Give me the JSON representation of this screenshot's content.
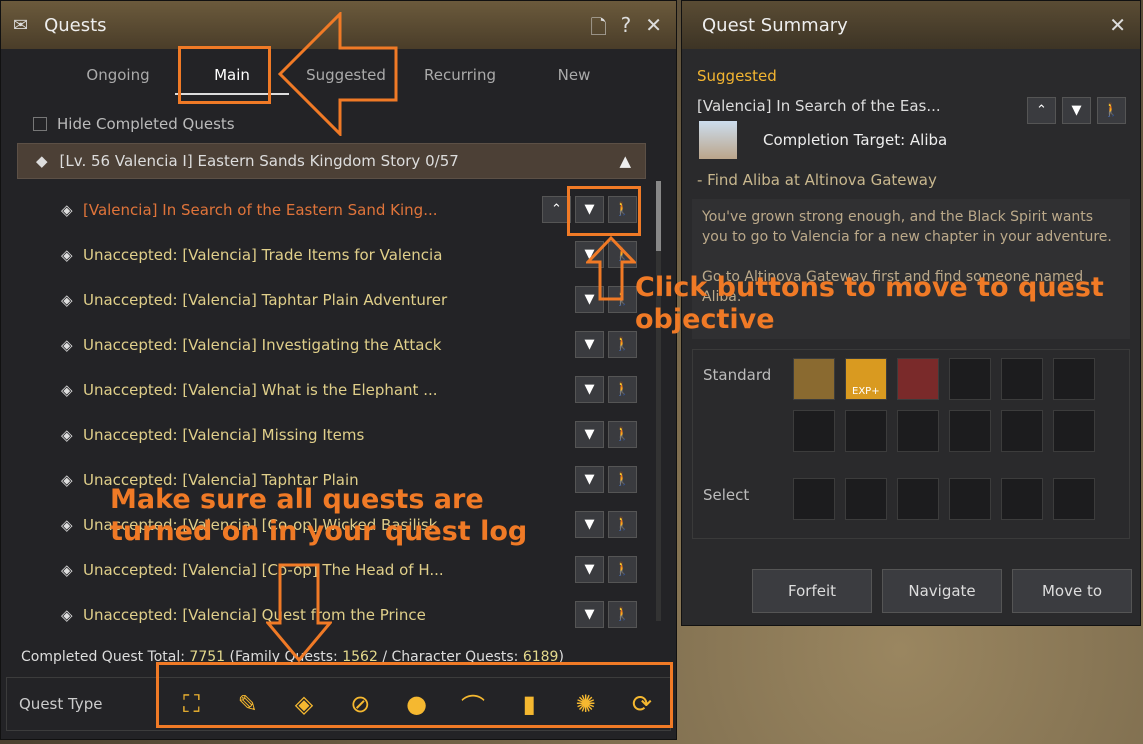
{
  "quests": {
    "title": "Quests",
    "tabs": [
      "Ongoing",
      "Main",
      "Suggested",
      "Recurring",
      "New"
    ],
    "active_tab": "Main",
    "hide_completed": "Hide Completed Quests",
    "group": {
      "title": "[Lv. 56 Valencia I] Eastern Sands Kingdom Story",
      "progress": "0/57"
    },
    "items": [
      "[Valencia] In Search of the Eastern Sand King...",
      "Unaccepted: [Valencia] Trade Items for Valencia",
      "Unaccepted: [Valencia] Taphtar Plain Adventurer",
      "Unaccepted: [Valencia] Investigating the Attack",
      "Unaccepted: [Valencia] What is the Elephant ...",
      "Unaccepted: [Valencia] Missing Items",
      "Unaccepted: [Valencia] Taphtar Plain",
      "Unaccepted: [Valencia] [Co-op] Wicked Basilisk",
      "Unaccepted: [Valencia] [Co-op] The Head of H...",
      "Unaccepted: [Valencia] Quest from the Prince"
    ],
    "total_label": "Completed Quest Total:",
    "total": "7751",
    "family_label": "(Family Quests:",
    "family": "1562",
    "char_label": "/ Character Quests:",
    "char": "6189",
    "quest_type_label": "Quest Type",
    "quest_type_icons": [
      "all-icon",
      "scroll-alert-icon",
      "diamond-icon",
      "feather-icon",
      "globe-icon",
      "pickaxe-icon",
      "book-icon",
      "party-icon",
      "repeat-icon"
    ]
  },
  "summary": {
    "title": "Quest Summary",
    "category": "Suggested",
    "quest": "[Valencia] In Search of the Eas...",
    "target": "Completion Target: Aliba",
    "objective": "- Find Aliba at Altinova Gateway",
    "desc1": "You've grown strong enough, and the Black Spirit wants you to go to Valencia for a new chapter in your adventure.",
    "desc2": "Go to Altinova Gateway first and find someone named Aliba.",
    "standard": "Standard",
    "select": "Select",
    "forfeit": "Forfeit",
    "navigate": "Navigate",
    "move_to": "Move to",
    "reward_badges": [
      "EXP+"
    ]
  },
  "annotations": {
    "buttons_note": "Click buttons to move to quest objective",
    "log_note": "Make sure all quests are turned on in your quest log"
  },
  "colors": {
    "accent": "#f07a26",
    "gold": "#f3b531",
    "current_quest": "#e0743a"
  }
}
